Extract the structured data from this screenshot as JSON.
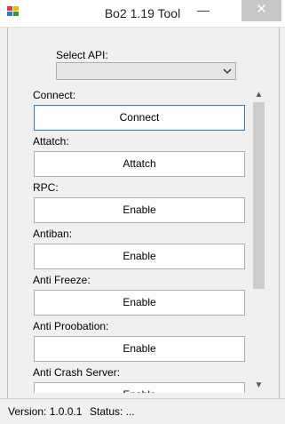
{
  "window": {
    "title": "Bo2 1.19 Tool",
    "minimize_glyph": "—",
    "close_glyph": "✕",
    "icon": "app-icon"
  },
  "api": {
    "label": "Select API:",
    "selected": ""
  },
  "sections": [
    {
      "label": "Connect:",
      "button": "Connect"
    },
    {
      "label": "Attatch:",
      "button": "Attatch"
    },
    {
      "label": "RPC:",
      "button": "Enable"
    },
    {
      "label": "Antiban:",
      "button": "Enable"
    },
    {
      "label": "Anti Freeze:",
      "button": "Enable"
    },
    {
      "label": "Anti Proobation:",
      "button": "Enable"
    },
    {
      "label": "Anti Crash Server:",
      "button": "Enable"
    }
  ],
  "scrollbar": {
    "up_glyph": "▲",
    "down_glyph": "▼"
  },
  "status": {
    "version": "Version:  1.0.0.1",
    "status": "Status:  ..."
  },
  "colors": {
    "focus_border": "#3c7fb1",
    "close_button_bg": "#c7c7c7"
  }
}
